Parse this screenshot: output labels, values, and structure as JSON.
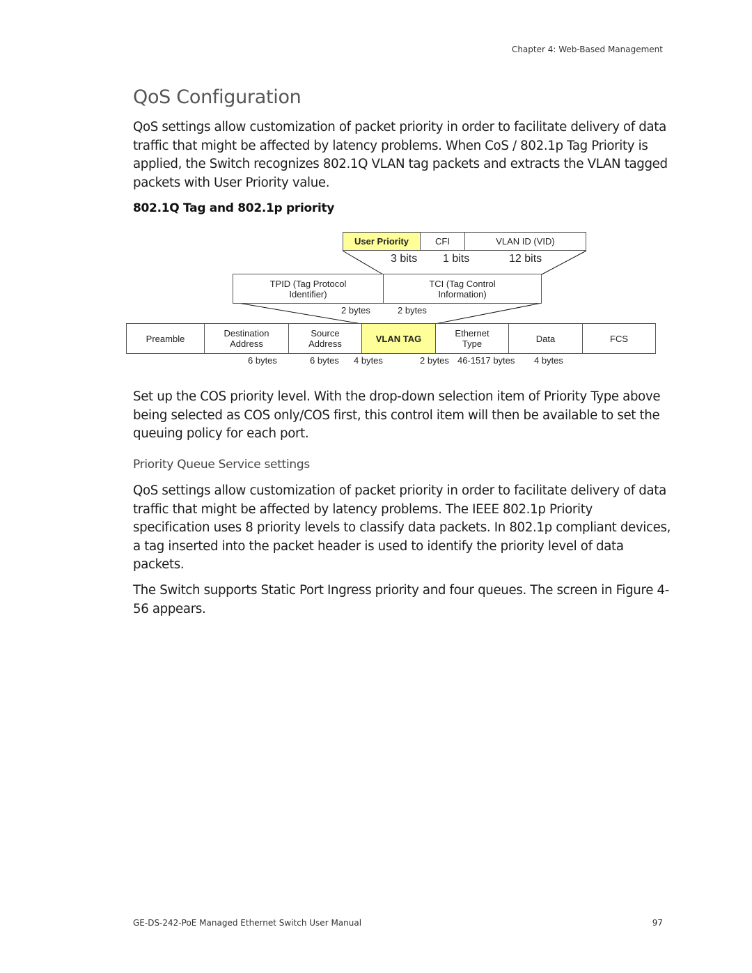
{
  "header": {
    "running_head": "Chapter 4: Web-Based Management"
  },
  "title": "QoS Configuration",
  "intro": "QoS settings allow customization of packet priority in order to facilitate delivery of data traffic that might be affected by latency problems. When CoS / 802.1p Tag Priority is applied, the Switch recognizes 802.1Q VLAN tag packets and extracts the VLAN tagged packets with User Priority value.",
  "section1_heading": "802.1Q Tag and 802.1p priority",
  "diagram": {
    "tci_fields": [
      {
        "label": "User Priority",
        "bits": "3 bits",
        "highlight": true
      },
      {
        "label": "CFI",
        "bits": "1 bits",
        "highlight": false
      },
      {
        "label": "VLAN ID (VID)",
        "bits": "12 bits",
        "highlight": false
      }
    ],
    "tag_fields": [
      {
        "label_line1": "TPID (Tag Protocol",
        "label_line2": "Identifier)",
        "size": "2 bytes"
      },
      {
        "label_line1": "TCI (Tag Control",
        "label_line2": "Information)",
        "size": "2 bytes"
      }
    ],
    "frame_fields": [
      {
        "label_line1": "Preamble",
        "label_line2": "",
        "size": ""
      },
      {
        "label_line1": "Destination",
        "label_line2": "Address",
        "size": "6 bytes"
      },
      {
        "label_line1": "Source",
        "label_line2": "Address",
        "size": "6 bytes"
      },
      {
        "label_line1": "VLAN TAG",
        "label_line2": "",
        "size": "4 bytes",
        "highlight": true
      },
      {
        "label_line1": "Ethernet",
        "label_line2": "Type",
        "size": "2 bytes"
      },
      {
        "label_line1": "Data",
        "label_line2": "",
        "size": "46-1517 bytes"
      },
      {
        "label_line1": "FCS",
        "label_line2": "",
        "size": "4 bytes"
      }
    ],
    "highlight_color": "#ffff99"
  },
  "para2": "Set up the COS priority level. With the drop-down selection item of Priority Type above being selected as COS only/COS first, this control item will then be available to set the queuing policy for each port.",
  "section2_heading": "Priority Queue Service settings",
  "para3": "QoS settings allow customization of packet priority in order to facilitate delivery of data traffic that might be affected by latency problems. The IEEE 802.1p Priority specification uses 8 priority levels to classify data packets. In 802.1p compliant devices, a tag inserted into the packet header is used to identify the priority level of data packets.",
  "para4": "The Switch supports Static Port Ingress priority and four queues. The screen in Figure 4-56 appears.",
  "footer": {
    "manual_title": "GE-DS-242-PoE Managed Ethernet Switch User Manual",
    "page_number": "97"
  }
}
